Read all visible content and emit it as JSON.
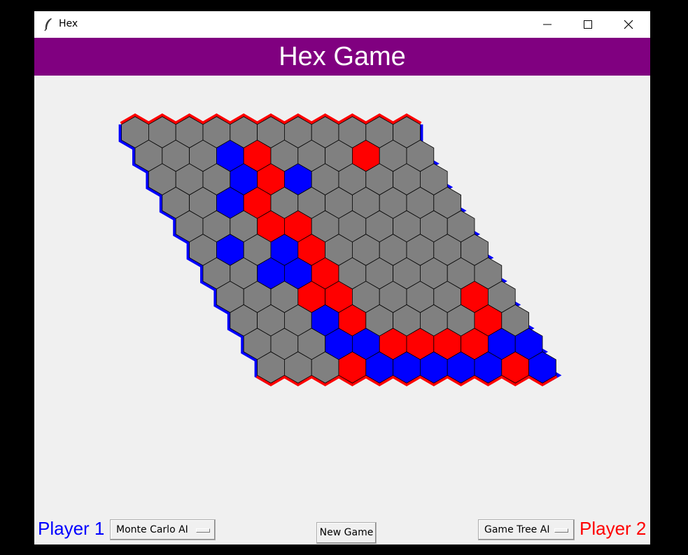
{
  "window": {
    "title": "Hex",
    "icon": "feather-icon"
  },
  "header": {
    "title": "Hex Game"
  },
  "colors": {
    "banner": "#800080",
    "player1": "#0000ff",
    "player2": "#ff0000",
    "empty": "#808080",
    "background": "#f0f0f0"
  },
  "game": {
    "board_size": 11,
    "cells_rows_top_to_bottom": [
      "...........",
      "...BR...R..",
      "...BRB.....",
      "..BR.......",
      "...RR......",
      ".B.BR......",
      "..BBR......",
      "...RR....R.",
      "...BR....R.",
      "...BBRRRRBB",
      "...RBBBBBRB"
    ],
    "legend": {
      "B": "player 1",
      "R": "player 2",
      ".": "empty"
    }
  },
  "controls": {
    "player1_label": "Player 1",
    "player1_ai": "Monte Carlo AI",
    "new_game_label": "New Game",
    "player2_ai": "Game Tree AI",
    "player2_label": "Player 2"
  }
}
